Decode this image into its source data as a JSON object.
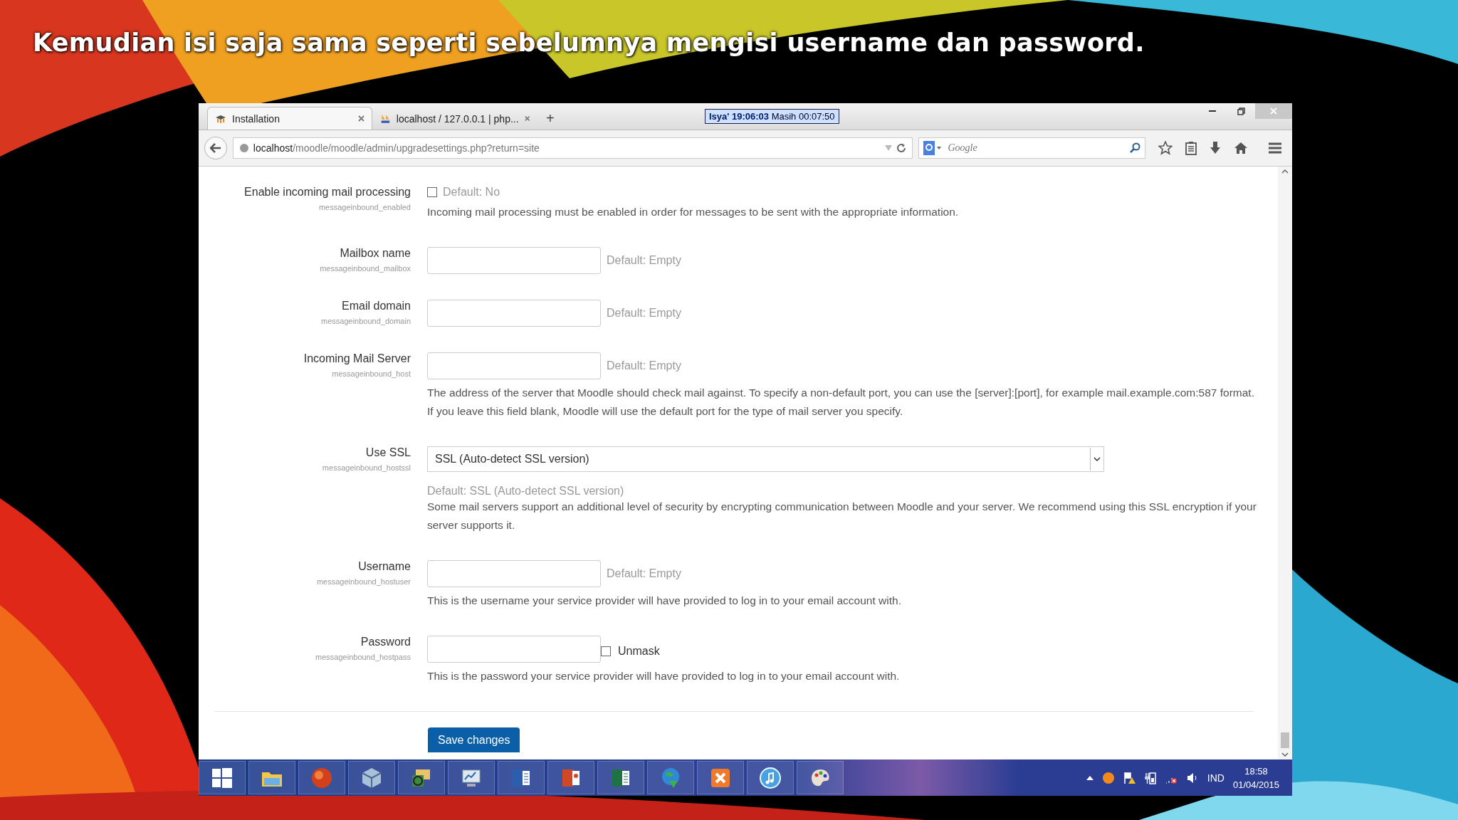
{
  "slide_title": "Kemudian isi saja sama seperti sebelumnya mengisi username dan password.",
  "browser": {
    "tabs": [
      {
        "label": "Installation",
        "selected": true
      },
      {
        "label": "localhost / 127.0.0.1 | php...",
        "selected": false
      }
    ],
    "new_tab": "+",
    "prayer_time": {
      "name": "Isya' 19:06:03",
      "remaining": "Masih 00:07:50"
    },
    "url": {
      "host": "localhost",
      "path": "/moodle/moodle/admin/upgradesettings.php?return=site"
    },
    "search": {
      "placeholder": "Google"
    }
  },
  "settings": [
    {
      "kind": "checkbox",
      "label": "Enable incoming mail processing",
      "key": "messageinbound_enabled",
      "checked": false,
      "default": "Default: No",
      "description": "Incoming mail processing must be enabled in order for messages to be sent with the appropriate information."
    },
    {
      "kind": "text",
      "label": "Mailbox name",
      "key": "messageinbound_mailbox",
      "default": "Default: Empty"
    },
    {
      "kind": "text",
      "label": "Email domain",
      "key": "messageinbound_domain",
      "default": "Default: Empty"
    },
    {
      "kind": "text",
      "label": "Incoming Mail Server",
      "key": "messageinbound_host",
      "default": "Default: Empty",
      "description": "The address of the server that Moodle should check mail against. To specify a non-default port, you can use the [server]:[port], for example mail.example.com:587 format. If you leave this field blank, Moodle will use the default port for the type of mail server you specify."
    },
    {
      "kind": "select",
      "label": "Use SSL",
      "key": "messageinbound_hostssl",
      "value": "SSL (Auto-detect SSL version)",
      "default": "Default: SSL (Auto-detect SSL version)",
      "description": "Some mail servers support an additional level of security by encrypting communication between Moodle and your server. We recommend using this SSL encryption if your server supports it."
    },
    {
      "kind": "text",
      "label": "Username",
      "key": "messageinbound_hostuser",
      "default": "Default: Empty",
      "description": "This is the username your service provider will have provided to log in to your email account with."
    },
    {
      "kind": "password",
      "label": "Password",
      "key": "messageinbound_hostpass",
      "unmask_label": "Unmask",
      "unmask_checked": false,
      "description": "This is the password your service provider will have provided to log in to your email account with."
    }
  ],
  "save_button": "Save changes",
  "taskbar": {
    "language": "IND",
    "time": "18:58",
    "date": "01/04/2015"
  }
}
